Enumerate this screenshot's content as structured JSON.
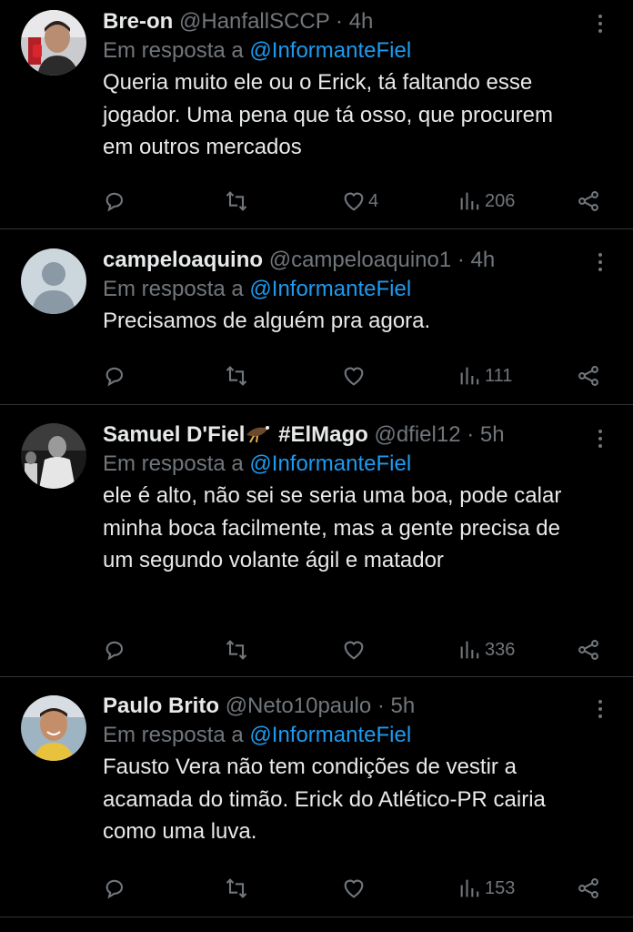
{
  "tweets": [
    {
      "name": "Bre-on",
      "handle": "@HanfallSCCP",
      "separator": "·",
      "time": "4h",
      "reply_prefix": "Em resposta a",
      "reply_to": "@InformanteFiel",
      "body": "Queria muito ele ou o Erick, tá faltando esse jogador. Uma pena que tá osso, que procurem em outros mercados",
      "likes": "4",
      "views": "206"
    },
    {
      "name": "campeloaquino",
      "handle": "@campeloaquino1",
      "separator": "·",
      "time": "4h",
      "reply_prefix": "Em resposta a",
      "reply_to": "@InformanteFiel",
      "body": "Precisamos de alguém pra agora.",
      "likes": "",
      "views": "111"
    },
    {
      "name": "Samuel D'Fiel",
      "name_suffix": "#ElMago",
      "handle": "@dfiel12",
      "separator": "·",
      "time": "5h",
      "reply_prefix": "Em resposta a",
      "reply_to": "@InformanteFiel",
      "body": "ele é alto, não sei se seria uma boa, pode calar minha boca facilmente, mas a gente precisa de um segundo volante ágil e matador",
      "likes": "",
      "views": "336"
    },
    {
      "name": "Paulo Brito",
      "handle": "@Neto10paulo",
      "separator": "·",
      "time": "5h",
      "reply_prefix": "Em resposta a",
      "reply_to": "@InformanteFiel",
      "body": "Fausto Vera não tem condições de vestir a acamada do timão. Erick do Atlético-PR cairia como uma luva.",
      "likes": "",
      "views": "153"
    }
  ],
  "icons": {
    "reply": "reply-icon",
    "retweet": "retweet-icon",
    "like": "heart-icon",
    "views": "views-icon",
    "share": "share-icon",
    "more": "more-options-icon"
  },
  "colors": {
    "background": "#000000",
    "text": "#e7e9ea",
    "muted": "#71767b",
    "link": "#1d9bf0",
    "divider": "#2f3336"
  }
}
